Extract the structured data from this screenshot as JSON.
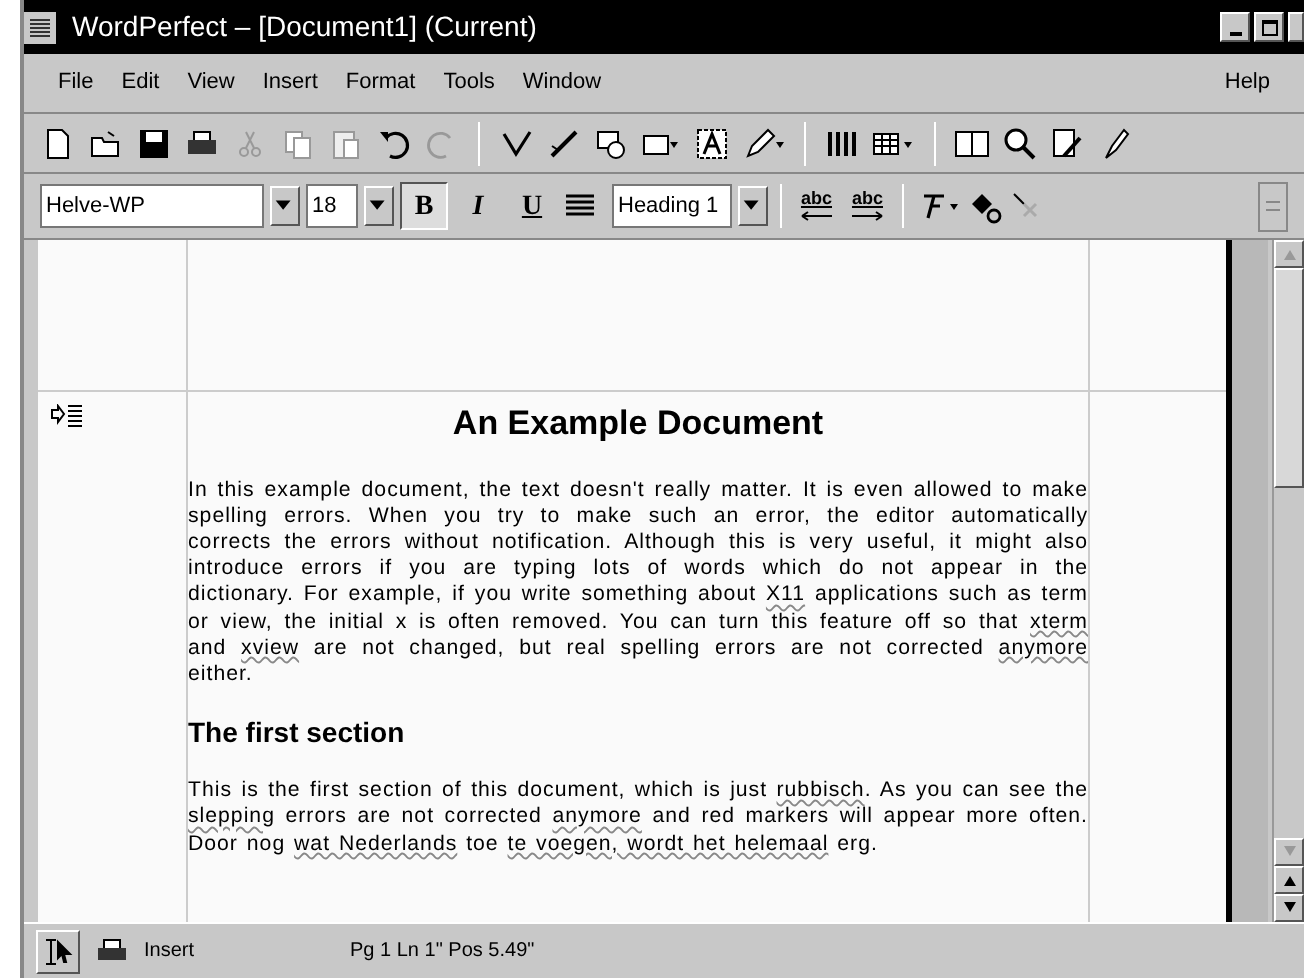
{
  "window": {
    "title": "WordPerfect – [Document1]  (Current)"
  },
  "menu": [
    "File",
    "Edit",
    "View",
    "Insert",
    "Format",
    "Tools",
    "Window"
  ],
  "help_menu": "Help",
  "property_bar": {
    "font": "Helve-WP",
    "size": "18",
    "style": "Heading 1",
    "spell_buttons": [
      {
        "kind": "left",
        "label": "abc"
      },
      {
        "kind": "right",
        "label": "abc"
      }
    ],
    "format_buttons": [
      {
        "kind": "bold",
        "label": "B",
        "selected": true
      },
      {
        "kind": "italic",
        "label": "I",
        "selected": false
      },
      {
        "kind": "underline",
        "label": "U",
        "selected": false
      }
    ]
  },
  "document": {
    "heading": "An Example Document",
    "paragraphs": [
      [
        {
          "text": "In this example document, the text doesn't really matter.  It is even allowed to make spelling errors.  When you try to make such an error, the editor automatically corrects the errors without notification. Although this is very useful, it might also introduce errors if you are typing lots of words which do not appear in the dictionary. For example, if you write something about ",
          "misspelled": false
        },
        {
          "text": "X11",
          "misspelled": true
        },
        {
          "text": " applications such as term or view, the initial x is often removed. You can turn this feature off so that ",
          "misspelled": false
        },
        {
          "text": "xterm",
          "misspelled": true
        },
        {
          "text": " and ",
          "misspelled": false
        },
        {
          "text": "xview",
          "misspelled": true
        },
        {
          "text": " are not changed, but real spelling errors are not corrected ",
          "misspelled": false
        },
        {
          "text": "anymore",
          "misspelled": true
        },
        {
          "text": " either.",
          "misspelled": false
        }
      ]
    ],
    "section_heading": "The first section",
    "section_paragraphs": [
      [
        {
          "text": "This is the first section of this document, which is just ",
          "misspelled": false
        },
        {
          "text": "rubbisch",
          "misspelled": true
        },
        {
          "text": ".  As you can see the ",
          "misspelled": false
        },
        {
          "text": "slepping",
          "misspelled": true
        },
        {
          "text": " errors are not corrected ",
          "misspelled": false
        },
        {
          "text": "anymore",
          "misspelled": true
        },
        {
          "text": " and red markers will appear more often. Door nog ",
          "misspelled": false
        },
        {
          "text": "wat Nederlands",
          "misspelled": true
        },
        {
          "text": " toe ",
          "misspelled": false
        },
        {
          "text": "te voegen, wordt het helemaal",
          "misspelled": true
        },
        {
          "text": " erg.",
          "misspelled": false
        }
      ]
    ]
  },
  "status_bar": {
    "mode": "Insert",
    "position": "Pg 1 Ln 1\" Pos 5.49\""
  }
}
